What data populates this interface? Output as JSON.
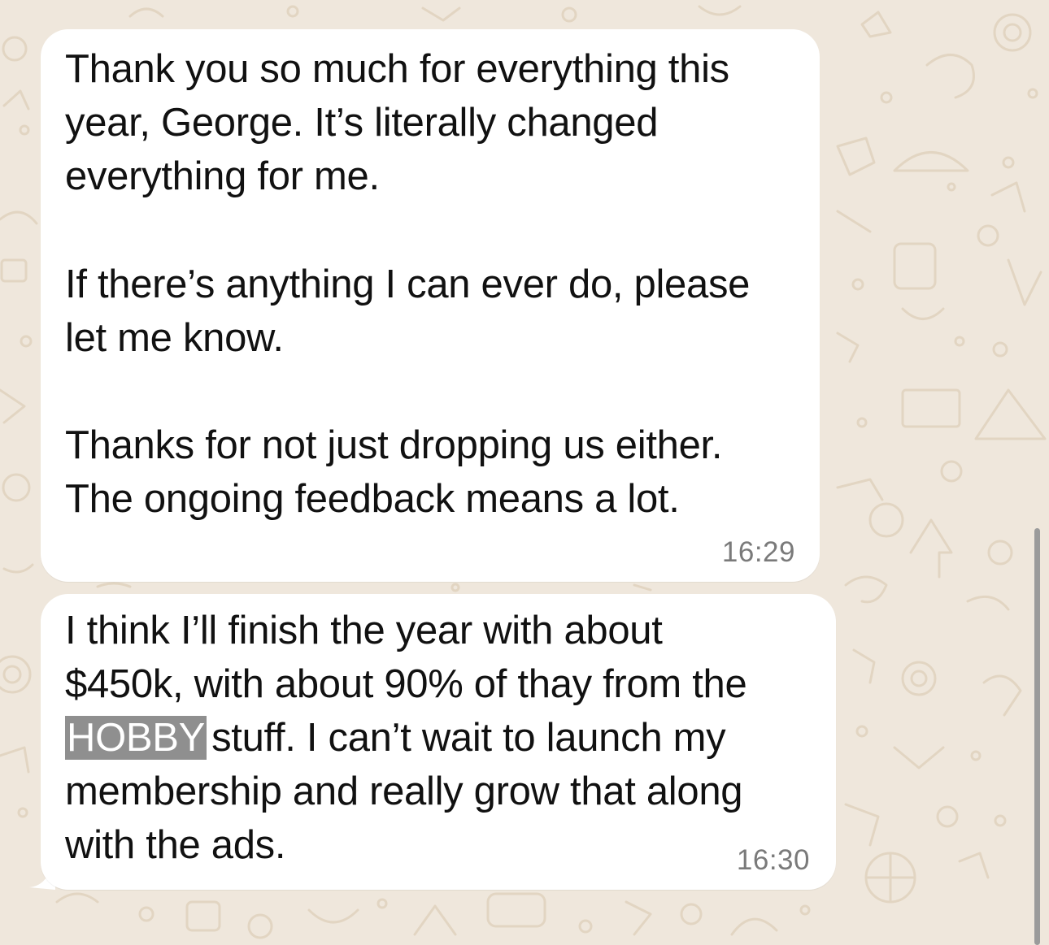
{
  "colors": {
    "wallpaper": "#efe7dc",
    "wallpaper_doodle": "#e4d8c6",
    "bubble": "#ffffff",
    "text": "#111111",
    "timestamp": "#7a7a7a",
    "redaction": "#8f8f8f"
  },
  "messages": [
    {
      "paragraphs": [
        {
          "lines": [
            "Thank you so much for everything this",
            "year, George. It’s literally changed",
            "everything for me."
          ]
        },
        {
          "lines": [
            "If there’s anything I can ever do, please",
            "let me know."
          ]
        },
        {
          "lines": [
            "Thanks for not just dropping us either.",
            "The ongoing feedback means a lot."
          ]
        }
      ],
      "time": "16:29"
    },
    {
      "lines": [
        "I think I’ll finish the year with about",
        "$450k, with about 90% of thay from the",
        {
          "redacted": "HOBBY",
          "rest": "stuff. I can’t wait to launch my"
        },
        "membership and really grow that along",
        "with the ads."
      ],
      "time": "16:30"
    }
  ]
}
